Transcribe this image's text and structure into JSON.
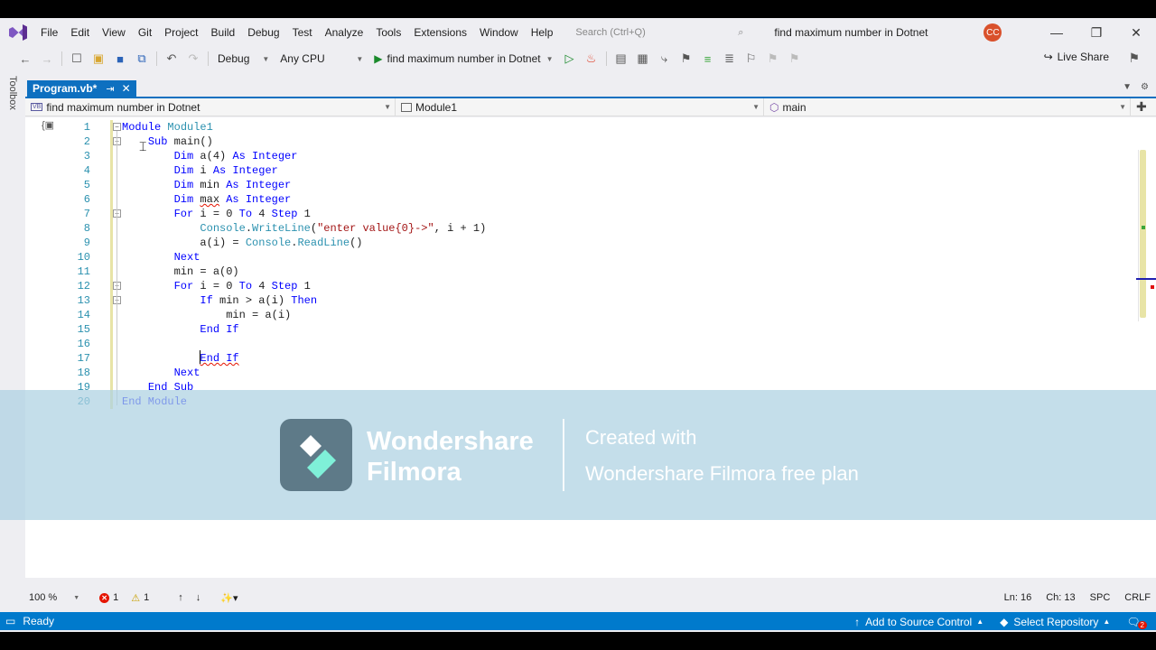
{
  "menu": {
    "items": [
      "File",
      "Edit",
      "View",
      "Git",
      "Project",
      "Build",
      "Debug",
      "Test",
      "Analyze",
      "Tools",
      "Extensions",
      "Window",
      "Help"
    ],
    "search_placeholder": "Search (Ctrl+Q)",
    "window_title": "find maximum number in Dotnet",
    "avatar_initials": "CC"
  },
  "toolbar": {
    "configuration": "Debug",
    "platform": "Any CPU",
    "run_target": "find maximum number in Dotnet",
    "live_share": "Live Share"
  },
  "toolbox_label": "Toolbox",
  "tab": {
    "label": "Program.vb*"
  },
  "navbar": {
    "project": "find maximum number in Dotnet",
    "type": "Module1",
    "member": "main"
  },
  "code": {
    "line_numbers": [
      "1",
      "2",
      "3",
      "4",
      "5",
      "6",
      "7",
      "8",
      "9",
      "10",
      "11",
      "12",
      "13",
      "14",
      "15",
      "16",
      "17",
      "18",
      "19",
      "20"
    ],
    "lines": [
      [
        {
          "t": "Module ",
          "c": "kw"
        },
        {
          "t": "Module1",
          "c": "ty"
        }
      ],
      [
        {
          "t": "    "
        },
        {
          "t": "Sub ",
          "c": "kw"
        },
        {
          "t": "main()"
        }
      ],
      [
        {
          "t": "        "
        },
        {
          "t": "Dim ",
          "c": "kw"
        },
        {
          "t": "a(4) "
        },
        {
          "t": "As Integer",
          "c": "kw"
        }
      ],
      [
        {
          "t": "        "
        },
        {
          "t": "Dim ",
          "c": "kw"
        },
        {
          "t": "i "
        },
        {
          "t": "As Integer",
          "c": "kw"
        }
      ],
      [
        {
          "t": "        "
        },
        {
          "t": "Dim ",
          "c": "kw"
        },
        {
          "t": "min "
        },
        {
          "t": "As Integer",
          "c": "kw"
        }
      ],
      [
        {
          "t": "        "
        },
        {
          "t": "Dim ",
          "c": "kw"
        },
        {
          "t": "max",
          "c": "squig-plain"
        },
        {
          "t": " "
        },
        {
          "t": "As Integer",
          "c": "kw"
        }
      ],
      [
        {
          "t": "        "
        },
        {
          "t": "For ",
          "c": "kw"
        },
        {
          "t": "i = 0 "
        },
        {
          "t": "To ",
          "c": "kw"
        },
        {
          "t": "4 "
        },
        {
          "t": "Step ",
          "c": "kw"
        },
        {
          "t": "1"
        }
      ],
      [
        {
          "t": "            "
        },
        {
          "t": "Console",
          "c": "ty"
        },
        {
          "t": "."
        },
        {
          "t": "WriteLine",
          "c": "ty"
        },
        {
          "t": "("
        },
        {
          "t": "\"enter value{0}->\"",
          "c": "str"
        },
        {
          "t": ", i + 1)"
        }
      ],
      [
        {
          "t": "            "
        },
        {
          "t": "a(i) = "
        },
        {
          "t": "Console",
          "c": "ty"
        },
        {
          "t": "."
        },
        {
          "t": "ReadLine",
          "c": "ty"
        },
        {
          "t": "()"
        }
      ],
      [
        {
          "t": "        "
        },
        {
          "t": "Next",
          "c": "kw"
        }
      ],
      [
        {
          "t": "        "
        },
        {
          "t": "min = a(0)"
        }
      ],
      [
        {
          "t": "        "
        },
        {
          "t": "For ",
          "c": "kw"
        },
        {
          "t": "i = 0 "
        },
        {
          "t": "To ",
          "c": "kw"
        },
        {
          "t": "4 "
        },
        {
          "t": "Step ",
          "c": "kw"
        },
        {
          "t": "1"
        }
      ],
      [
        {
          "t": "            "
        },
        {
          "t": "If ",
          "c": "kw"
        },
        {
          "t": "min > a(i) "
        },
        {
          "t": "Then",
          "c": "kw"
        }
      ],
      [
        {
          "t": "                "
        },
        {
          "t": "min = a(i)"
        }
      ],
      [
        {
          "t": "            "
        },
        {
          "t": "End If",
          "c": "kw"
        }
      ],
      [
        {
          "t": ""
        }
      ],
      [
        {
          "t": "            "
        },
        {
          "t": "End If",
          "c": "kw squig"
        }
      ],
      [
        {
          "t": "        "
        },
        {
          "t": "Next",
          "c": "kw"
        }
      ],
      [
        {
          "t": "    "
        },
        {
          "t": "End Sub",
          "c": "kw"
        }
      ],
      [
        {
          "t": "End Module",
          "c": "kw"
        }
      ]
    ]
  },
  "watermark": {
    "brand_line1": "Wondershare",
    "brand_line2": "Filmora",
    "created": "Created with",
    "plan": "Wondershare Filmora free plan"
  },
  "editor_status": {
    "zoom": "100 %",
    "errors": "1",
    "warnings": "1",
    "ln": "Ln: 16",
    "ch": "Ch: 13",
    "spc": "SPC",
    "crlf": "CRLF"
  },
  "statusbar": {
    "ready": "Ready",
    "source_control": "Add to Source Control",
    "repository": "Select Repository",
    "notifications": "2"
  },
  "colors": {
    "accent": "#007acc",
    "tab": "#0e70c0",
    "keyword": "#0000ff",
    "type": "#2b91af",
    "string": "#a31515"
  }
}
